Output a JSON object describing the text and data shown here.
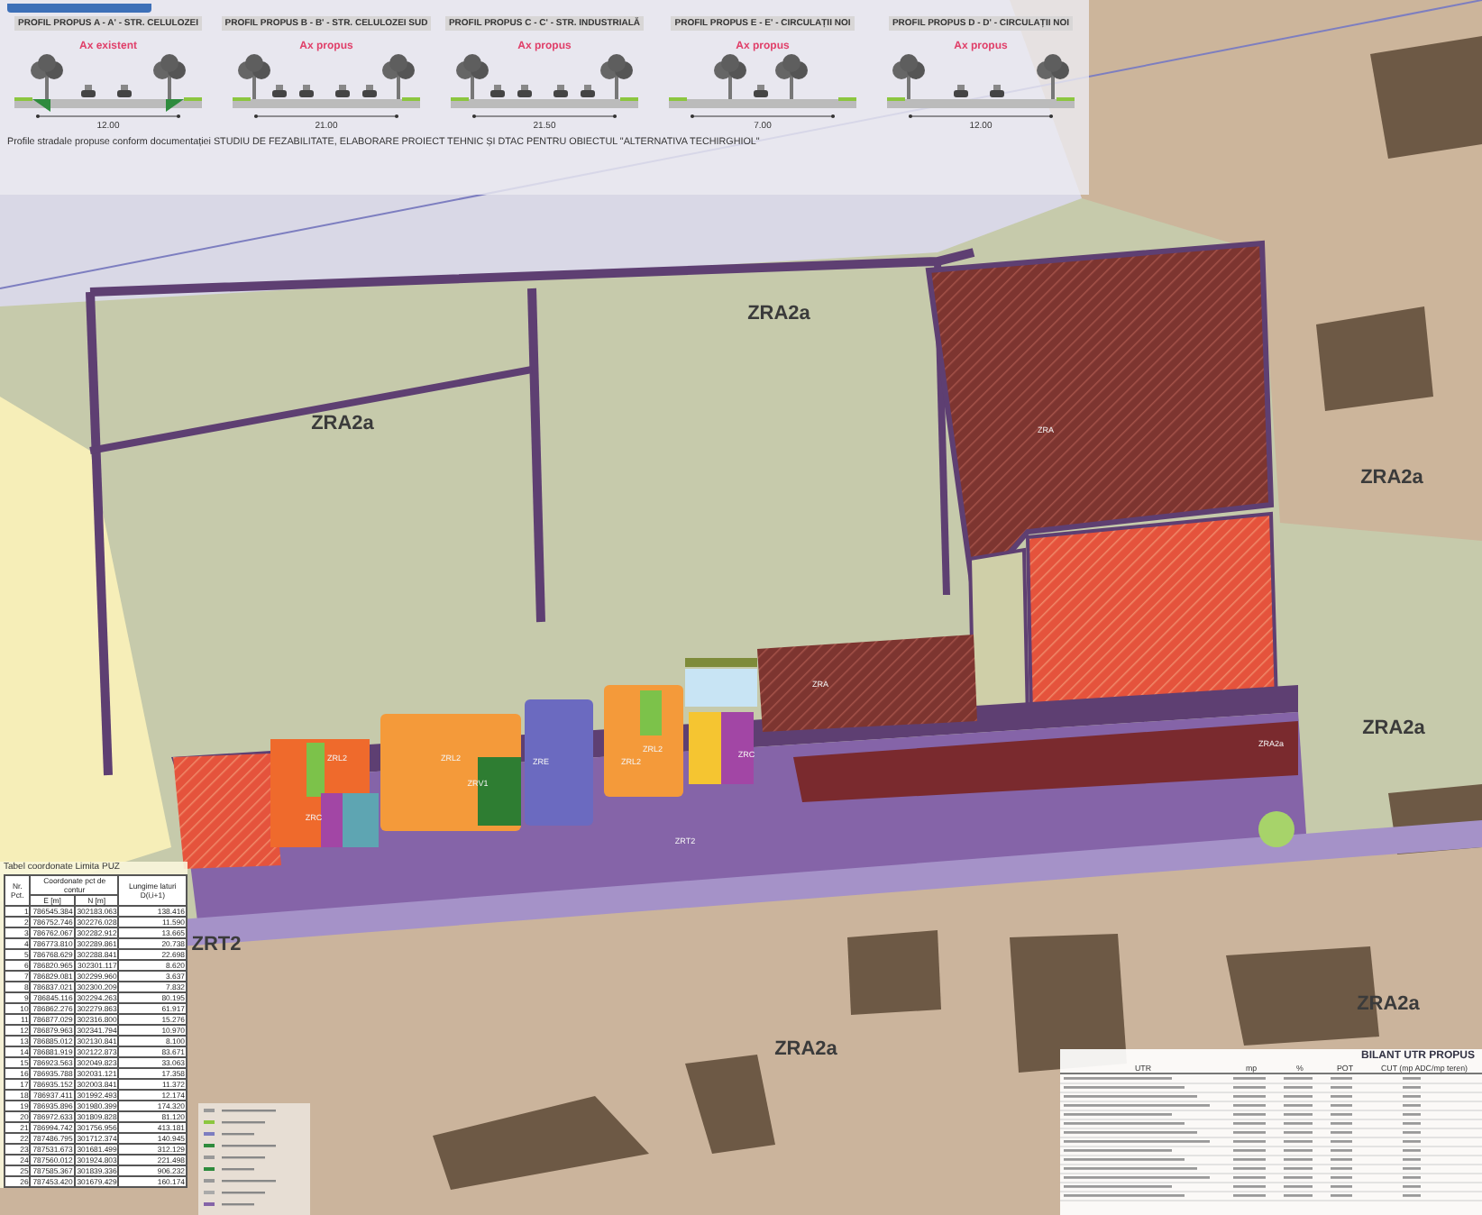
{
  "profiles_panel": {
    "profiles": [
      {
        "title": "PROFIL PROPUS A - A' - STR. CELULOZEI",
        "axis_label": "Ax existent",
        "total": "12.00",
        "kind": "ditch"
      },
      {
        "title": "PROFIL PROPUS B - B' - STR. CELULOZEI SUD",
        "axis_label": "Ax propus",
        "total": "21.00",
        "kind": "four_lane"
      },
      {
        "title": "PROFIL PROPUS C - C' - STR. INDUSTRIALĂ",
        "axis_label": "Ax propus",
        "total": "21.50",
        "kind": "four_lane"
      },
      {
        "title": "PROFIL PROPUS E - E' - CIRCULAȚII NOI",
        "axis_label": "Ax propus",
        "total": "7.00",
        "kind": "one_lane"
      },
      {
        "title": "PROFIL PROPUS D - D' - CIRCULAȚII NOI",
        "axis_label": "Ax propus",
        "total": "12.00",
        "kind": "two_lane"
      }
    ],
    "note": "Profile stradale propuse conform documentației STUDIU DE FEZABILITATE, ELABORARE PROIECT TEHNIC ȘI DTAC PENTRU OBIECTUL \"ALTERNATIVA TECHIRGHIOL\""
  },
  "map": {
    "zone_labels": [
      {
        "label": "ZRA2a",
        "kind": "major"
      },
      {
        "label": "ZRA2a",
        "kind": "major"
      },
      {
        "label": "ZRA2a",
        "kind": "major"
      },
      {
        "label": "ZRA2a",
        "kind": "major"
      },
      {
        "label": "ZRA2a",
        "kind": "major"
      },
      {
        "label": "ZRA2a",
        "kind": "major"
      },
      {
        "label": "ZRT2",
        "kind": "major"
      },
      {
        "label": "ZRA",
        "kind": "minor"
      },
      {
        "label": "ZRA",
        "kind": "minor"
      },
      {
        "label": "ZRL2",
        "kind": "minor"
      },
      {
        "label": "ZRL2",
        "kind": "minor"
      },
      {
        "label": "ZRL2",
        "kind": "minor"
      },
      {
        "label": "ZRL2",
        "kind": "minor"
      },
      {
        "label": "ZRV1",
        "kind": "minor"
      },
      {
        "label": "ZRE",
        "kind": "minor"
      },
      {
        "label": "ZRC",
        "kind": "minor"
      },
      {
        "label": "ZRC",
        "kind": "minor"
      },
      {
        "label": "ZRT2",
        "kind": "minor"
      },
      {
        "label": "ZRA2a",
        "kind": "minor"
      }
    ]
  },
  "coordinates_table": {
    "title": "Tabel coordonate Limita PUZ",
    "col_nr": "Nr. Pct.",
    "col_coords": "Coordonate pct de contur",
    "col_e": "E [m]",
    "col_n": "N [m]",
    "col_len": "Lungime laturi D(i,i+1)",
    "rows": [
      {
        "nr": "1",
        "e": "786545.384",
        "n": "302183.063",
        "len": "138.416"
      },
      {
        "nr": "2",
        "e": "786752.746",
        "n": "302276.028",
        "len": "11.590"
      },
      {
        "nr": "3",
        "e": "786762.067",
        "n": "302282.912",
        "len": "13.665"
      },
      {
        "nr": "4",
        "e": "786773.810",
        "n": "302289.861",
        "len": "20.738"
      },
      {
        "nr": "5",
        "e": "786768.629",
        "n": "302288.841",
        "len": "22.698"
      },
      {
        "nr": "6",
        "e": "786820.965",
        "n": "302301.117",
        "len": "8.620"
      },
      {
        "nr": "7",
        "e": "786829.081",
        "n": "302299.960",
        "len": "3.637"
      },
      {
        "nr": "8",
        "e": "786837.021",
        "n": "302300.209",
        "len": "7.832"
      },
      {
        "nr": "9",
        "e": "786845.116",
        "n": "302294.263",
        "len": "80.195"
      },
      {
        "nr": "10",
        "e": "786862.276",
        "n": "302279.863",
        "len": "61.917"
      },
      {
        "nr": "11",
        "e": "786877.029",
        "n": "302316.800",
        "len": "15.276"
      },
      {
        "nr": "12",
        "e": "786879.963",
        "n": "302341.794",
        "len": "10.970"
      },
      {
        "nr": "13",
        "e": "786885.012",
        "n": "302130.841",
        "len": "8.100"
      },
      {
        "nr": "14",
        "e": "786881.919",
        "n": "302122.873",
        "len": "83.671"
      },
      {
        "nr": "15",
        "e": "786923.563",
        "n": "302049.823",
        "len": "33.063"
      },
      {
        "nr": "16",
        "e": "786935.788",
        "n": "302031.121",
        "len": "17.358"
      },
      {
        "nr": "17",
        "e": "786935.152",
        "n": "302003.841",
        "len": "11.372"
      },
      {
        "nr": "18",
        "e": "786937.411",
        "n": "301992.493",
        "len": "12.174"
      },
      {
        "nr": "19",
        "e": "786935.896",
        "n": "301980.399",
        "len": "174.320"
      },
      {
        "nr": "20",
        "e": "786972.633",
        "n": "301809.828",
        "len": "81.120"
      },
      {
        "nr": "21",
        "e": "786994.742",
        "n": "301756.956",
        "len": "413.181"
      },
      {
        "nr": "22",
        "e": "787486.795",
        "n": "301712.374",
        "len": "140.945"
      },
      {
        "nr": "23",
        "e": "787531.673",
        "n": "301681.499",
        "len": "312.129"
      },
      {
        "nr": "24",
        "e": "787560.012",
        "n": "301924.803",
        "len": "221.498"
      },
      {
        "nr": "25",
        "e": "787585.367",
        "n": "301839.336",
        "len": "906.232"
      },
      {
        "nr": "26",
        "e": "787453.420",
        "n": "301679.429",
        "len": "160.174"
      }
    ]
  },
  "balance_table": {
    "title": "BILANT UTR PROPUS",
    "columns": [
      "UTR",
      "mp",
      "%",
      "POT",
      "CUT (mp ADC/mp teren)"
    ]
  }
}
